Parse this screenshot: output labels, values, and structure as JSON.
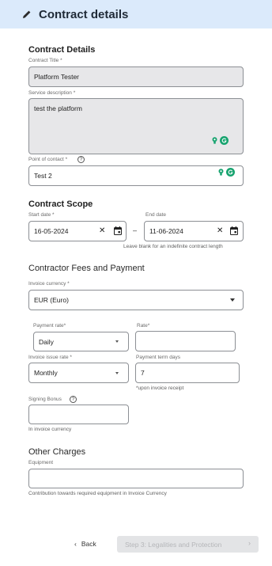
{
  "header": {
    "title": "Contract details",
    "icon": "pencil-icon",
    "bg": "#dbeafb"
  },
  "contract_details": {
    "heading": "Contract Details",
    "contract_title_label": "Contract Title *",
    "contract_title_value": "Platform Tester",
    "service_description_label": "Service description *",
    "service_description_value": "test the platform",
    "point_of_contact_label": "Point of contact *",
    "point_of_contact_value": "Test 2"
  },
  "contract_scope": {
    "heading": "Contract Scope",
    "start_date_label": "Start date *",
    "start_date_value": "16-05-2024",
    "end_date_label": "End date",
    "end_date_value": "11-06-2024",
    "separator": "–",
    "end_date_help": "Leave blank for an indefinite contract length"
  },
  "fees": {
    "heading": "Contractor Fees and Payment",
    "invoice_currency_label": "Invoice currency *",
    "invoice_currency_value": "EUR (Euro)",
    "payment_rate_label": "Payment rate*",
    "payment_rate_value": "Daily",
    "rate_label": "Rate*",
    "rate_value": "",
    "invoice_issue_rate_label": "Invoice issue rate *",
    "invoice_issue_rate_value": "Monthly",
    "payment_term_label": "Payment term days",
    "payment_term_value": "7",
    "payment_term_help": "*upon invoice receipt",
    "signing_bonus_label": "Signing Bonus",
    "signing_bonus_value": "",
    "signing_bonus_help": "In invoice currency"
  },
  "other_charges": {
    "heading": "Other Charges",
    "equipment_label": "Equipment",
    "equipment_value": "",
    "equipment_help": "Contribution towards required equipment in Invoice Currency"
  },
  "footer": {
    "back_label": "Back",
    "next_label": "Step 3: Legalities and Protection"
  },
  "colors": {
    "grammarly": "#17a36f",
    "disabled_field": "#e7e7e9",
    "border": "#8c8f94"
  }
}
